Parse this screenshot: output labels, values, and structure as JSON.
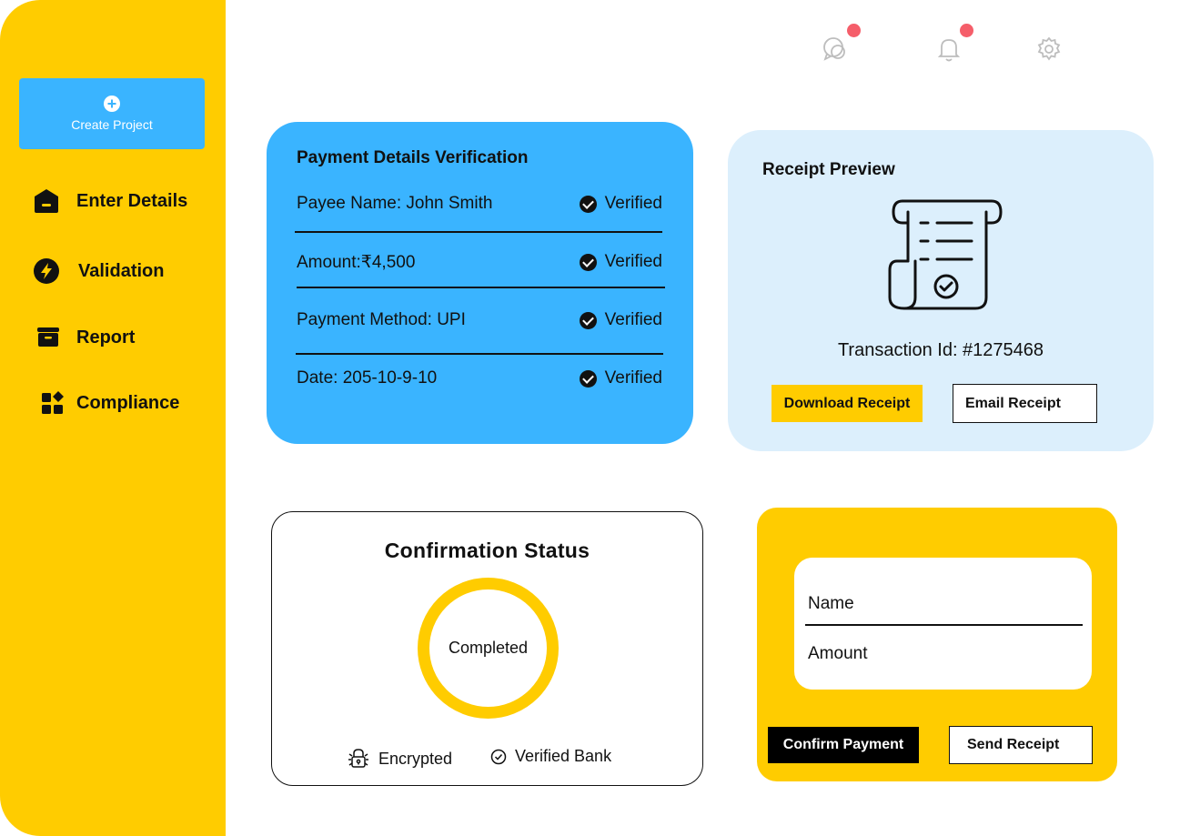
{
  "sidebar": {
    "create_label": "Create Project",
    "items": [
      {
        "label": "Enter Details",
        "icon": "home-icon"
      },
      {
        "label": "Validation",
        "icon": "lightning-icon"
      },
      {
        "label": "Report",
        "icon": "archive-icon"
      },
      {
        "label": "Compliance",
        "icon": "grid-icon"
      }
    ]
  },
  "header": {
    "icons": [
      "chat-icon",
      "bell-icon",
      "gear-icon"
    ]
  },
  "payment": {
    "title": "Payment Details Verification",
    "rows": [
      {
        "label": "Payee Name: John Smith",
        "status": "Verified"
      },
      {
        "label": "Amount:₹4,500",
        "status": "Verified"
      },
      {
        "label": "Payment Method: UPI",
        "status": "Verified"
      },
      {
        "label": "Date: 205-10-9-10",
        "status": "Verified"
      }
    ]
  },
  "receipt": {
    "title": "Receipt Preview",
    "transaction": "Transaction Id: #1275468",
    "download_label": "Download Receipt",
    "email_label": "Email Receipt"
  },
  "confirmation": {
    "title": "Confirmation Status",
    "status": "Completed",
    "badges": [
      "Encrypted",
      "Verified Bank"
    ]
  },
  "form": {
    "fields": [
      "Name",
      "Amount"
    ],
    "confirm_label": "Confirm Payment",
    "send_label": "Send Receipt"
  },
  "colors": {
    "yellow": "#FFCC00",
    "blue": "#3AB4FF",
    "light_blue": "#DCEFFC",
    "notification": "#F55E6A"
  }
}
